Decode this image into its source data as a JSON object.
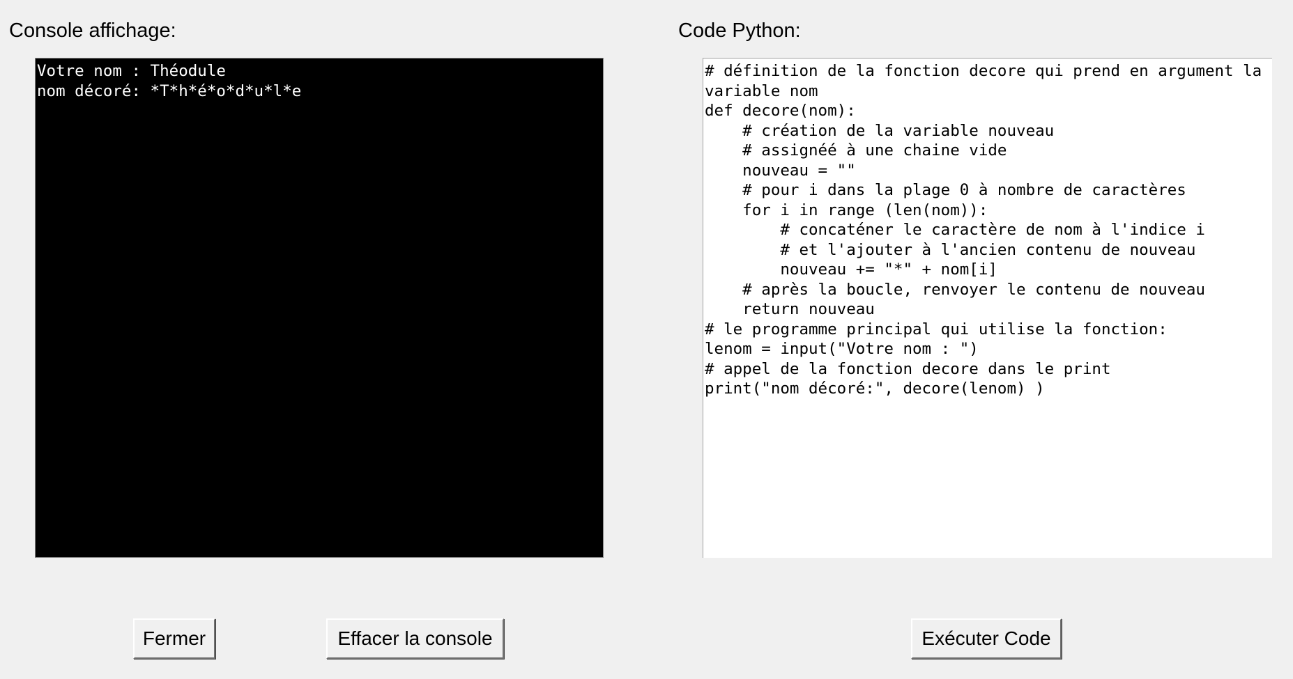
{
  "console_panel": {
    "label": "Console affichage:",
    "output": "Votre nom : Théodule\nnom décoré: *T*h*é*o*d*u*l*e"
  },
  "code_panel": {
    "label": "Code Python:",
    "code": "# définition de la fonction decore qui prend en argument la\nvariable nom\ndef decore(nom):\n    # création de la variable nouveau\n    # assignéé à une chaine vide\n    nouveau = \"\"\n    # pour i dans la plage 0 à nombre de caractères\n    for i in range (len(nom)):\n        # concaténer le caractère de nom à l'indice i\n        # et l'ajouter à l'ancien contenu de nouveau\n        nouveau += \"*\" + nom[i]\n    # après la boucle, renvoyer le contenu de nouveau\n    return nouveau\n# le programme principal qui utilise la fonction:\nlenom = input(\"Votre nom : \")\n# appel de la fonction decore dans le print\nprint(\"nom décoré:\", decore(lenom) )"
  },
  "buttons": {
    "close_label": "Fermer",
    "clear_console_label": "Effacer la console",
    "run_code_label": "Exécuter Code"
  },
  "colors": {
    "window_background": "#f0f0f0",
    "console_background": "#000000",
    "console_text": "#ffffff",
    "editor_background": "#ffffff"
  }
}
